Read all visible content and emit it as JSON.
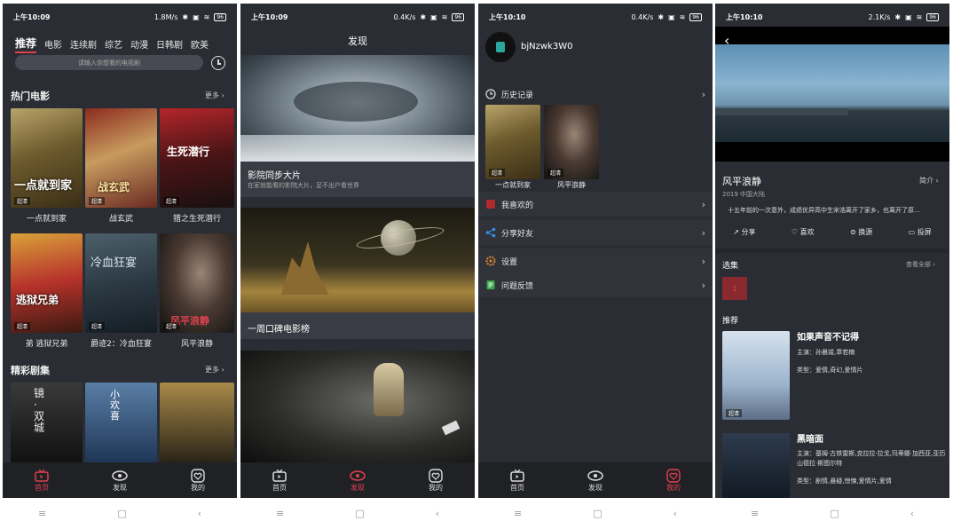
{
  "screens": [
    {
      "status": {
        "time": "上午10:09",
        "speed": "1.8M/s",
        "battery": "96"
      },
      "category_tabs": [
        "推荐",
        "电影",
        "连续剧",
        "综艺",
        "动漫",
        "日韩剧",
        "欧美"
      ],
      "search": {
        "placeholder": "请输入你想看的电视剧"
      },
      "hot_movies": {
        "title": "热门电影",
        "more": "更多",
        "items": [
          {
            "title": "一点就到家",
            "badge": "超清"
          },
          {
            "title": "战玄武",
            "badge": "超清"
          },
          {
            "title": "猎之生死潜行",
            "badge": "超清"
          },
          {
            "title": "弟 逃狱兄弟",
            "badge": "超清"
          },
          {
            "title": "爵迹2：冷血狂宴",
            "badge": "超清"
          },
          {
            "title": "风平浪静",
            "badge": "超清"
          }
        ],
        "poster_texts": [
          "一点就到家",
          "战玄武",
          "生死潜行",
          "逃狱兄弟",
          "冷血狂宴",
          "风平浪静"
        ]
      },
      "series": {
        "title": "精彩剧集",
        "more": "更多",
        "poster_texts": [
          "镜·双城",
          "小欢喜",
          ""
        ]
      },
      "tabbar": [
        {
          "label": "首页",
          "active": true
        },
        {
          "label": "发现",
          "active": false
        },
        {
          "label": "我的",
          "active": false
        }
      ]
    },
    {
      "status": {
        "time": "上午10:09",
        "speed": "0.4K/s",
        "battery": "96"
      },
      "header": "发现",
      "cards": [
        {
          "title": "影院同步大片",
          "subtitle": "在家就能看的影院大片，足不出户看世界"
        },
        {
          "title": "一周口碑电影榜",
          "subtitle": ""
        },
        {
          "title": "",
          "subtitle": ""
        }
      ],
      "tabbar": [
        {
          "label": "首页",
          "active": false
        },
        {
          "label": "发现",
          "active": true
        },
        {
          "label": "我的",
          "active": false
        }
      ]
    },
    {
      "status": {
        "time": "上午10:10",
        "speed": "0.4K/s",
        "battery": "96"
      },
      "username": "bjNzwk3W0",
      "history": {
        "title": "历史记录",
        "items": [
          {
            "title": "一点就到家",
            "badge": "超清"
          },
          {
            "title": "风平浪静",
            "badge": "超清"
          }
        ]
      },
      "menu": [
        "我喜欢的",
        "分享好友",
        "设置",
        "问题反馈"
      ],
      "tabbar": [
        {
          "label": "首页",
          "active": false
        },
        {
          "label": "发现",
          "active": false
        },
        {
          "label": "我的",
          "active": true
        }
      ]
    },
    {
      "status": {
        "time": "上午10:10",
        "speed": "2.1K/s",
        "battery": "96"
      },
      "title": "风平浪静",
      "intro_link": "简介",
      "meta": "2019 中国大陆",
      "summary": "十五年前的一次意外，成绩优异高中生宋浩离开了家乡，也离开了原...",
      "actions": [
        "分享",
        "喜欢",
        "换源",
        "投屏"
      ],
      "episodes": {
        "title": "选集",
        "all": "查看全部",
        "items": [
          "1"
        ]
      },
      "recommend": {
        "title": "推荐",
        "items": [
          {
            "title": "如果声音不记得",
            "cast": "主演：孙晨竣,章若楠",
            "genre": "类型：爱情,奇幻,爱情片",
            "badge": "超清"
          },
          {
            "title": "黑暗面",
            "cast": "主演：基姆·古铁雷斯,克拉拉·拉戈,玛蒂娜·加西亚,亚历山德拉·斯图尔特",
            "genre": "类型：剧情,悬疑,惊悚,爱情片,爱情",
            "badge": ""
          }
        ]
      }
    }
  ],
  "colors": {
    "accent": "#e0414f",
    "bg": "#2a2d33",
    "card": "#30333a",
    "bar": "#1f2125"
  },
  "navbar": [
    "≡",
    "□",
    "‹"
  ]
}
